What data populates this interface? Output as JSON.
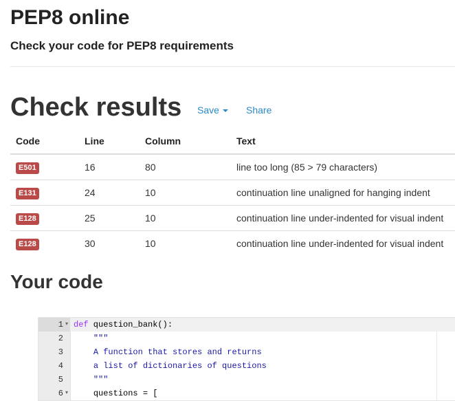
{
  "header": {
    "title": "PEP8 online",
    "subtitle": "Check your code for PEP8 requirements"
  },
  "results": {
    "title": "Check results",
    "save_label": "Save",
    "share_label": "Share",
    "columns": [
      "Code",
      "Line",
      "Column",
      "Text"
    ],
    "rows": [
      {
        "code": "E501",
        "line": "16",
        "column": "80",
        "text": "line too long (85 > 79 characters)"
      },
      {
        "code": "E131",
        "line": "24",
        "column": "10",
        "text": "continuation line unaligned for hanging indent"
      },
      {
        "code": "E128",
        "line": "25",
        "column": "10",
        "text": "continuation line under-indented for visual indent"
      },
      {
        "code": "E128",
        "line": "30",
        "column": "10",
        "text": "continuation line under-indented for visual indent"
      }
    ]
  },
  "code_section": {
    "title": "Your code",
    "lines": [
      {
        "n": "1",
        "fold": true,
        "kw": "def",
        "rest": " question_bank():",
        "indent": "",
        "str": ""
      },
      {
        "n": "2",
        "fold": false,
        "kw": "",
        "rest": "",
        "indent": "    ",
        "str": "\"\"\""
      },
      {
        "n": "3",
        "fold": false,
        "kw": "",
        "rest": "",
        "indent": "    ",
        "str": "A function that stores and returns"
      },
      {
        "n": "4",
        "fold": false,
        "kw": "",
        "rest": "",
        "indent": "    ",
        "str": "a list of dictionaries of questions"
      },
      {
        "n": "5",
        "fold": false,
        "kw": "",
        "rest": "",
        "indent": "    ",
        "str": "\"\"\""
      },
      {
        "n": "6",
        "fold": true,
        "kw": "",
        "rest": "questions = [",
        "indent": "    ",
        "str": ""
      }
    ]
  },
  "colors": {
    "accent": "#2a8ac9",
    "badge": "#b94a48",
    "keyword": "#9933ff",
    "string": "#1a1aa6"
  }
}
